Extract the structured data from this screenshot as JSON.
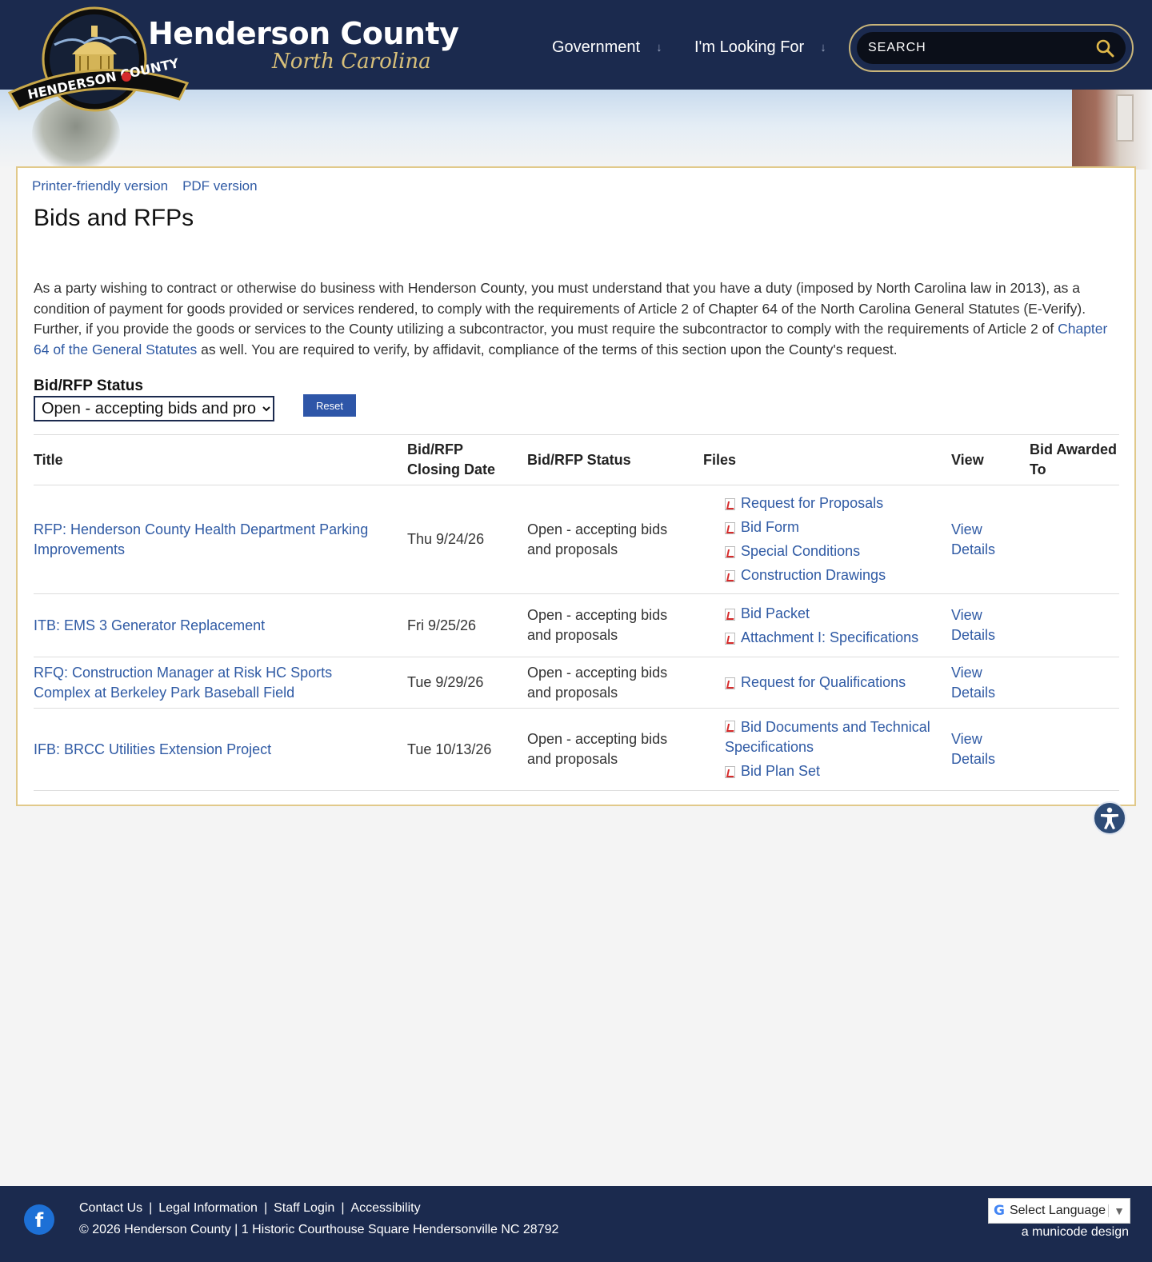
{
  "header": {
    "title": "Henderson County",
    "subtitle": "North Carolina",
    "seal_text": "HENDERSON COUNTY",
    "nav": [
      {
        "label": "Government"
      },
      {
        "label": "I'm Looking For"
      }
    ],
    "search_placeholder": "SEARCH"
  },
  "page": {
    "printer_link": "Printer-friendly version",
    "pdf_link": "PDF version",
    "title": "Bids and RFPs",
    "intro_part1": "As a party wishing to contract or otherwise do business with Henderson County, you must understand that you have a duty (imposed by North Carolina law in 2013), as a condition of payment for goods provided or services rendered, to comply with the requirements of Article 2 of Chapter 64 of the North Carolina General Statutes (E-Verify). Further, if you provide the goods or services to the County utilizing a subcontractor, you must require the subcontractor to comply with the requirements of Article 2 of ",
    "intro_link": "Chapter 64 of the General Statutes",
    "intro_part2": " as well. You are required to verify, by affidavit, compliance of the terms of this section upon the County's request.",
    "filter_label": "Bid/RFP Status",
    "filter_value": "Open - accepting bids and proposals",
    "reset_label": "Reset"
  },
  "table": {
    "headers": {
      "title": "Title",
      "closing": "Bid/RFP Closing Date",
      "status": "Bid/RFP Status",
      "files": "Files",
      "view": "View",
      "awarded": "Bid Awarded To"
    },
    "rows": [
      {
        "title": "RFP: Henderson County Health Department Parking Improvements",
        "closing": "Thu 9/24/26",
        "status": "Open - accepting bids and proposals",
        "files": [
          "Request for Proposals",
          "Bid Form",
          "Special Conditions",
          "Construction Drawings"
        ],
        "view": "View Details",
        "awarded": ""
      },
      {
        "title": "ITB: EMS 3 Generator Replacement",
        "closing": "Fri 9/25/26",
        "status": "Open - accepting bids and proposals",
        "files": [
          "Bid Packet",
          "Attachment I: Specifications"
        ],
        "view": "View Details",
        "awarded": ""
      },
      {
        "title": "RFQ: Construction Manager at Risk HC Sports Complex at Berkeley Park Baseball Field",
        "closing": "Tue 9/29/26",
        "status": "Open - accepting bids and proposals",
        "files": [
          "Request for Qualifications"
        ],
        "view": "View Details",
        "awarded": ""
      },
      {
        "title": "IFB: BRCC Utilities Extension Project",
        "closing": "Tue 10/13/26",
        "status": "Open - accepting bids and proposals",
        "files": [
          "Bid Documents and Technical Specifications",
          "Bid Plan Set"
        ],
        "view": "View Details",
        "awarded": ""
      }
    ]
  },
  "footer": {
    "links": [
      "Contact Us",
      "Legal Information",
      "Staff Login",
      "Accessibility"
    ],
    "copyright": "© 2026 Henderson County | 1 Historic Courthouse Square Hendersonville NC 28792",
    "translate_label": "Select Language",
    "credit": "a municode design"
  },
  "colors": {
    "header_bg": "#1b2a4e",
    "link": "#2f5aa4",
    "accent_gold": "#c9b57a",
    "button_blue": "#2e56a8"
  },
  "icons": [
    "county-seal-logo",
    "chevron-down-icon",
    "search-icon",
    "pdf-file-icon",
    "accessibility-icon",
    "facebook-icon",
    "google-translate-icon"
  ]
}
